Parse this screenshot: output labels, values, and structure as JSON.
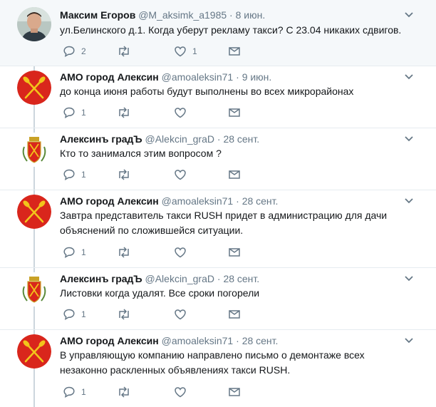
{
  "tweets": [
    {
      "name": "Максим Егоров",
      "handle": "@M_aksimk_a1985",
      "time": "8 июн.",
      "text": "ул.Белинского д.1. Когда уберут рекламу такси? С 23.04 никаких сдвигов.",
      "replies": "2",
      "retweets": "",
      "likes": "1",
      "avatar": "user-photo-avatar",
      "highlighted": true
    },
    {
      "name": "АМО город Алексин",
      "handle": "@amoaleksin71",
      "time": "9 июн.",
      "text": "до конца июня работы будут выполнены во всех микрорайонах",
      "replies": "1",
      "retweets": "",
      "likes": "",
      "avatar": "oars-emblem-avatar"
    },
    {
      "name": "Алексинъ градЪ",
      "handle": "@Alekcin_graD",
      "time": "28 сент.",
      "text": "Кто то занимался этим вопросом ?",
      "replies": "1",
      "retweets": "",
      "likes": "",
      "avatar": "coat-of-arms-avatar"
    },
    {
      "name": "АМО город Алексин",
      "handle": "@amoaleksin71",
      "time": "28 сент.",
      "text_lines": [
        "Завтра представитель такси RUSH придет в администрацию для дачи",
        "объяснений по сложившейся ситуации."
      ],
      "replies": "1",
      "retweets": "",
      "likes": "",
      "avatar": "oars-emblem-avatar"
    },
    {
      "name": "Алексинъ градЪ",
      "handle": "@Alekcin_graD",
      "time": "28 сент.",
      "text": "Листовки когда удалят. Все сроки погорели",
      "replies": "1",
      "retweets": "",
      "likes": "",
      "avatar": "coat-of-arms-avatar"
    },
    {
      "name": "АМО город Алексин",
      "handle": "@amoaleksin71",
      "time": "28 сент.",
      "text_lines": [
        "В управляющую компанию направлено письмо о демонтаже всех",
        "незаконно раскленных объявлениях такси RUSH."
      ],
      "replies": "1",
      "retweets": "",
      "likes": "",
      "avatar": "oars-emblem-avatar"
    }
  ],
  "colors": {
    "name": "#14171a",
    "secondary": "#657786",
    "divider": "#e6ecf0",
    "thread_line": "#ccd6dd",
    "highlight_bg": "#f5f8fa",
    "emblem_red": "#d9261c",
    "emblem_gold": "#f2c41b"
  }
}
